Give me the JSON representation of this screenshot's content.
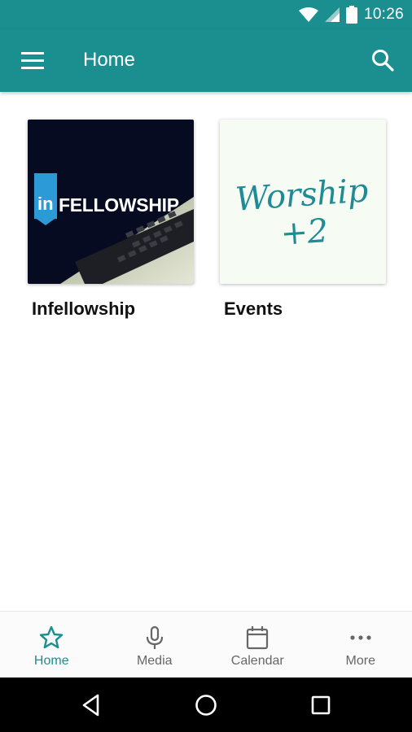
{
  "status_bar": {
    "time": "10:26",
    "icons": [
      "wifi-icon",
      "signal-icon",
      "battery-icon"
    ]
  },
  "app_bar": {
    "title": "Home",
    "menu_icon": "menu-icon",
    "search_icon": "search-icon",
    "color": "#1b8f8f"
  },
  "tiles": [
    {
      "label": "Infellowship",
      "image_text_in": "in",
      "image_text_main": "FELLOWSHIP"
    },
    {
      "label": "Events",
      "image_text": "Worship +2"
    }
  ],
  "bottom_nav": {
    "active_color": "#1b8f8f",
    "items": [
      {
        "label": "Home",
        "icon": "star-icon",
        "active": true
      },
      {
        "label": "Media",
        "icon": "microphone-icon",
        "active": false
      },
      {
        "label": "Calendar",
        "icon": "calendar-icon",
        "active": false
      },
      {
        "label": "More",
        "icon": "more-dots-icon",
        "active": false
      }
    ]
  },
  "system_nav": {
    "icons": [
      "back-icon",
      "home-circle-icon",
      "recents-square-icon"
    ]
  }
}
